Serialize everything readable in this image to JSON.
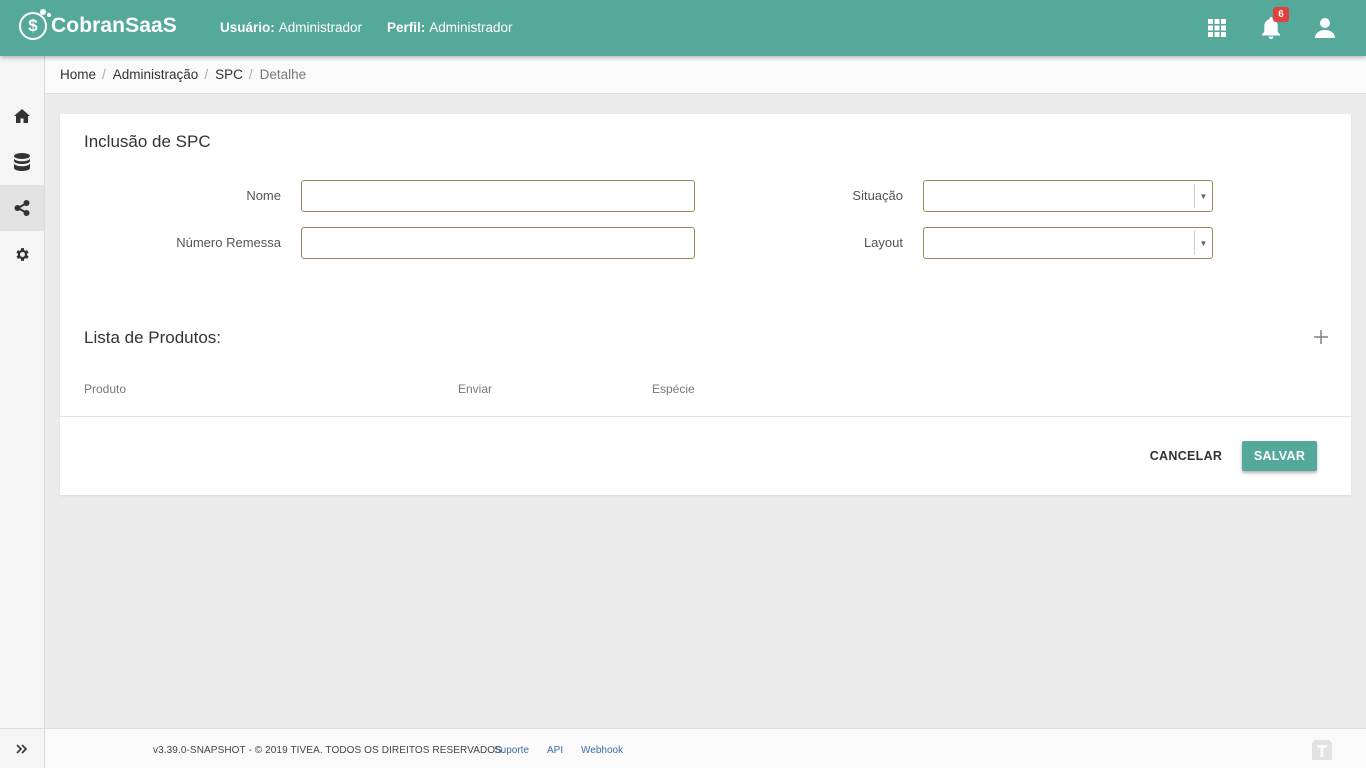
{
  "header": {
    "logo_text": "CobranSaaS",
    "user_label": "Usuário:",
    "user_value": "Administrador",
    "profile_label": "Perfil:",
    "profile_value": "Administrador",
    "notifications_count": "6",
    "accent_color": "#55a99a",
    "icons": [
      "apps-icon",
      "bell-icon",
      "user-icon"
    ]
  },
  "sidebar": {
    "items": [
      {
        "icon": "home-icon",
        "active": false
      },
      {
        "icon": "database-icon",
        "active": false
      },
      {
        "icon": "share-icon",
        "active": true
      },
      {
        "icon": "gear-icon",
        "active": false
      }
    ],
    "expand_icon": "double-chevron-right-icon"
  },
  "breadcrumb": {
    "items": [
      "Home",
      "Administração",
      "SPC"
    ],
    "current": "Detalhe",
    "separator": "/"
  },
  "form": {
    "title": "Inclusão de SPC",
    "fields": {
      "nome": {
        "label": "Nome",
        "value": ""
      },
      "numero_remessa": {
        "label": "Número Remessa",
        "value": ""
      },
      "situacao": {
        "label": "Situação",
        "value": ""
      },
      "layout": {
        "label": "Layout",
        "value": ""
      }
    }
  },
  "products": {
    "title": "Lista de Produtos:",
    "columns": [
      "Produto",
      "Enviar",
      "Espécie"
    ],
    "rows": []
  },
  "actions": {
    "cancel_label": "CANCELAR",
    "save_label": "SALVAR"
  },
  "footer": {
    "copyright": "v3.39.0-SNAPSHOT - © 2019 TIVEA. TODOS OS DIREITOS RESERVADOS.",
    "links": [
      "Suporte",
      "API",
      "Webhook"
    ]
  }
}
